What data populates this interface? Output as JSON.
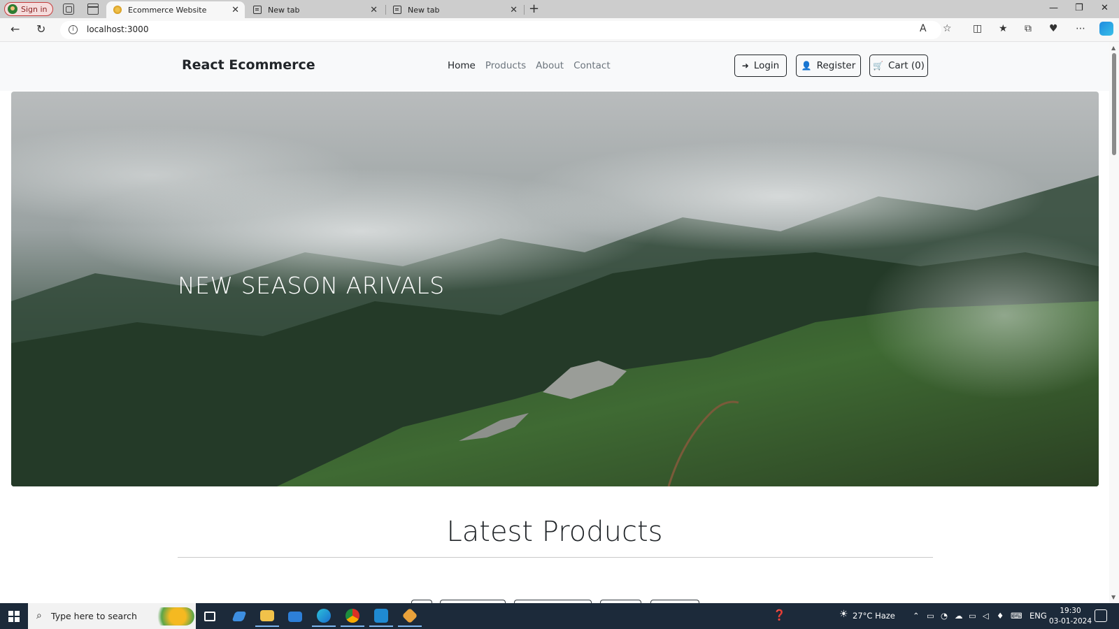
{
  "browser": {
    "signin_label": "Sign in",
    "tabs": [
      {
        "title": "Ecommerce Website",
        "favicon": "react-favicon-icon"
      },
      {
        "title": "New tab",
        "favicon": "page-icon"
      },
      {
        "title": "New tab",
        "favicon": "page-icon"
      }
    ],
    "url": "localhost:3000"
  },
  "site": {
    "brand": "React Ecommerce",
    "nav": [
      "Home",
      "Products",
      "About",
      "Contact"
    ],
    "active_nav": "Home",
    "login_label": "Login",
    "register_label": "Register",
    "cart_label": "Cart (0)",
    "hero_title": "NEW SEASON ARIVALS",
    "section_title": "Latest Products"
  },
  "taskbar": {
    "search_placeholder": "Type here to search",
    "weather": "27°C  Haze",
    "language": "ENG",
    "time": "19:30",
    "date": "03-01-2024"
  },
  "colors": {
    "nav_bg": "#f8f9fa",
    "text_dark": "#212529",
    "text_muted": "#6c757d",
    "taskbar_bg": "#1c2a3a"
  }
}
